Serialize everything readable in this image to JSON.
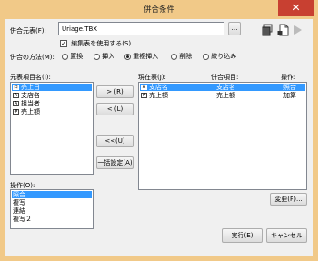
{
  "window": {
    "title": "併合条件",
    "close_glyph": "✕"
  },
  "master_file": {
    "label": "併合元表(F):",
    "value": "Uriage.TBX",
    "use_edited_label": "編集表を使用する(S)",
    "use_edited_checked": true
  },
  "method": {
    "label": "併合の方法(M):",
    "options": [
      {
        "label": "置換",
        "selected": false
      },
      {
        "label": "挿入",
        "selected": false
      },
      {
        "label": "重複挿入",
        "selected": true
      },
      {
        "label": "削除",
        "selected": false
      },
      {
        "label": "絞り込み",
        "selected": false
      }
    ]
  },
  "source_list": {
    "label": "元表項目名(I):",
    "items": [
      {
        "type": "date",
        "type_glyph": "日",
        "name": "売上日",
        "selected": true
      },
      {
        "type": "text",
        "type_glyph": "A",
        "name": "支店名",
        "selected": false
      },
      {
        "type": "text",
        "type_glyph": "A",
        "name": "担当者",
        "selected": false
      },
      {
        "type": "number",
        "type_glyph": "#",
        "name": "売上額",
        "selected": false
      }
    ]
  },
  "buttons": {
    "add": "> (R)",
    "remove": "< (L)",
    "remove_all": "<<(U)",
    "bulk": "一括設定(A)",
    "change": "変更(P)...",
    "run": "実行(E)",
    "cancel": "キャンセル"
  },
  "current_table": {
    "label": "現在表(J):",
    "col_merge": "併合項目:",
    "col_op": "操作:",
    "rows": [
      {
        "type": "text",
        "type_glyph": "A",
        "name": "支店名",
        "merge": "支店名",
        "op": "照合",
        "selected": true
      },
      {
        "type": "number",
        "type_glyph": "#",
        "name": "売上額",
        "merge": "売上額",
        "op": "加算",
        "selected": false
      }
    ]
  },
  "operation": {
    "label": "操作(O):",
    "items": [
      {
        "label": "照合",
        "selected": true
      },
      {
        "label": "複写",
        "selected": false
      },
      {
        "label": "連結",
        "selected": false
      },
      {
        "label": "複写２",
        "selected": false
      }
    ]
  },
  "icons": [
    "database-icon",
    "new-document-icon",
    "play-icon"
  ]
}
